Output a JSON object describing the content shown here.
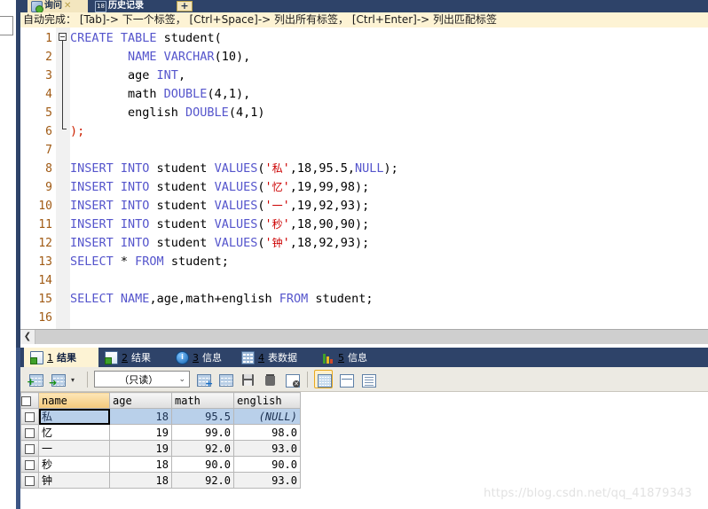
{
  "window": {
    "tabs": [
      {
        "label": "询问",
        "icon": "query-icon",
        "active": true,
        "closable": true
      },
      {
        "label": "历史记录",
        "icon": "history-icon",
        "badge": "18",
        "active": false,
        "closable": false
      }
    ],
    "new_tab_label": "+"
  },
  "hint_bar": {
    "text": "自动完成： [Tab]-> 下一个标签， [Ctrl+Space]-> 列出所有标签， [Ctrl+Enter]-> 列出匹配标签"
  },
  "editor": {
    "lines": [
      {
        "n": "1",
        "text": "CREATE TABLE student("
      },
      {
        "n": "2",
        "text": "        NAME VARCHAR(10),"
      },
      {
        "n": "3",
        "text": "        age INT,"
      },
      {
        "n": "4",
        "text": "        math DOUBLE(4,1),"
      },
      {
        "n": "5",
        "text": "        english DOUBLE(4,1)"
      },
      {
        "n": "6",
        "text": ");"
      },
      {
        "n": "7",
        "text": ""
      },
      {
        "n": "8",
        "text": "INSERT INTO student VALUES('私',18,95.5,NULL);"
      },
      {
        "n": "9",
        "text": "INSERT INTO student VALUES('忆',19,99,98);"
      },
      {
        "n": "10",
        "text": "INSERT INTO student VALUES('一',19,92,93);"
      },
      {
        "n": "11",
        "text": "INSERT INTO student VALUES('秒',18,90,90);"
      },
      {
        "n": "12",
        "text": "INSERT INTO student VALUES('钟',18,92,93);"
      },
      {
        "n": "13",
        "text": "SELECT * FROM student;"
      },
      {
        "n": "14",
        "text": ""
      },
      {
        "n": "15",
        "text": "SELECT NAME,age,math+english FROM student;"
      },
      {
        "n": "16",
        "text": ""
      }
    ]
  },
  "hscroll": {
    "left_arrow": "❮"
  },
  "result_tabs": [
    {
      "num": "1",
      "label": "结果",
      "icon": "result-grid-icon",
      "active": true
    },
    {
      "num": "2",
      "label": "结果",
      "icon": "result-grid-icon",
      "active": false
    },
    {
      "num": "3",
      "label": "信息",
      "icon": "info-icon",
      "active": false
    },
    {
      "num": "4",
      "label": "表数据",
      "icon": "table-data-icon",
      "active": false
    },
    {
      "num": "5",
      "label": "信息",
      "icon": "chart-info-icon",
      "active": false
    }
  ],
  "result_toolbar": {
    "mode_select": {
      "value": "（只读）",
      "caret": "⌄"
    },
    "buttons": [
      {
        "name": "add-record-button",
        "icon": "grid-plus-icon"
      },
      {
        "name": "export-grid-button",
        "icon": "grid-arrow-icon"
      },
      {
        "name": "grid-dropdown-button",
        "icon": "chevron-down-icon",
        "caret": "▾"
      },
      {
        "name": "insert-row-button",
        "icon": "row-insert-icon"
      },
      {
        "name": "duplicate-row-button",
        "icon": "row-duplicate-icon"
      },
      {
        "name": "save-button",
        "icon": "save-icon"
      },
      {
        "name": "delete-row-button",
        "icon": "trash-icon"
      },
      {
        "name": "discard-changes-button",
        "icon": "grid-cancel-icon"
      },
      {
        "name": "grid-view-button",
        "icon": "grid-view-icon",
        "selected": true
      },
      {
        "name": "form-view-button",
        "icon": "form-view-icon",
        "selected": false
      },
      {
        "name": "text-view-button",
        "icon": "text-view-icon",
        "selected": false
      }
    ]
  },
  "result_grid": {
    "columns": [
      "name",
      "age",
      "math",
      "english"
    ],
    "rows": [
      {
        "name": "私",
        "age": "18",
        "math": "95.5",
        "english": "(NULL)",
        "selected": true
      },
      {
        "name": "忆",
        "age": "19",
        "math": "99.0",
        "english": "98.0",
        "selected": false
      },
      {
        "name": "一",
        "age": "19",
        "math": "92.0",
        "english": "93.0",
        "selected": false
      },
      {
        "name": "秒",
        "age": "18",
        "math": "90.0",
        "english": "90.0",
        "selected": false
      },
      {
        "name": "钟",
        "age": "18",
        "math": "92.0",
        "english": "93.0",
        "selected": false
      }
    ]
  },
  "watermark": {
    "text": "https://blog.csdn.net/qq_41879343"
  },
  "colors": {
    "chrome": "#2e4369",
    "active_tab": "#fdf3d4",
    "hint_bar": "#fdf3d4",
    "keyword": "#5555cc",
    "string": "#cc0000",
    "line_number": "#a05a14",
    "row_selected": "#b9d0ea",
    "name_header": "#f4c97a"
  }
}
